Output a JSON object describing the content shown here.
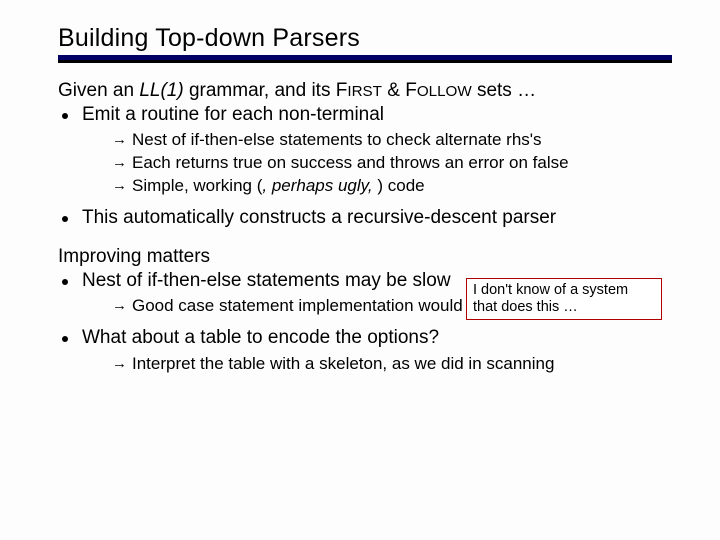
{
  "title": "Building Top-down Parsers",
  "intro": "Given an LL(1) grammar, and its FIRST & FOLLOW sets …",
  "bullets": {
    "b1": "Emit a routine for each non-terminal",
    "b1_subs": {
      "s1": "Nest of if-then-else statements to check alternate rhs's",
      "s2": "Each returns true on success and throws an error on false",
      "s3_a": "Simple, working (",
      "s3_i": ", perhaps ugly,",
      "s3_b": " ) code"
    },
    "b2": "This automatically constructs a recursive-descent parser",
    "section2": "Improving matters",
    "b3": "Nest of if-then-else statements may be slow",
    "b3_subs": {
      "s1": "Good case statement implementation would be better"
    },
    "b4": "What about a table to encode the options?",
    "b4_subs": {
      "s1": "Interpret the table with a skeleton, as we did in scanning"
    }
  },
  "callout": "I don't know of a system that does this …"
}
